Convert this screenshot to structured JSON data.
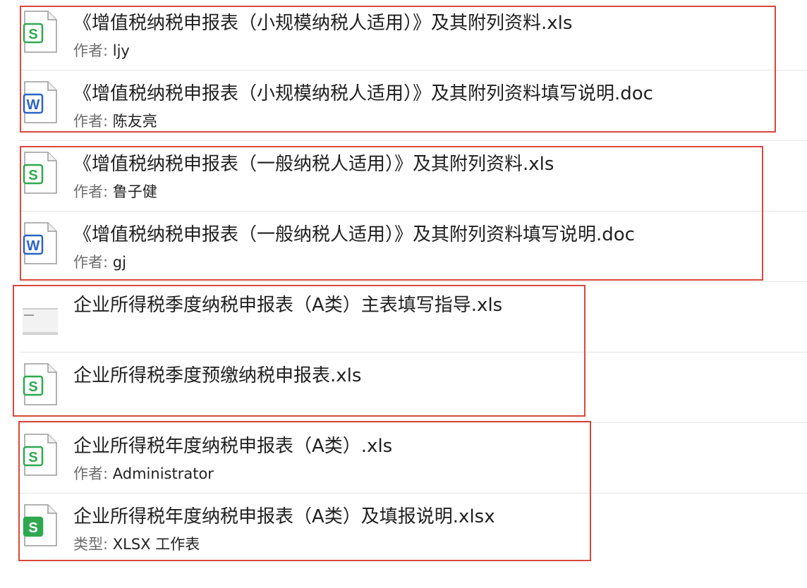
{
  "files": [
    {
      "title": "《增值税纳税申报表（小规模纳税人适用）》及其附列资料.xls",
      "meta_label": "作者: ",
      "meta_value": "ljy",
      "icon": "spreadsheet-icon"
    },
    {
      "title": "《增值税纳税申报表（小规模纳税人适用）》及其附列资料填写说明.doc",
      "meta_label": "作者: ",
      "meta_value": "陈友亮",
      "icon": "word-document-icon"
    },
    {
      "title": "《增值税纳税申报表（一般纳税人适用）》及其附列资料.xls",
      "meta_label": "作者: ",
      "meta_value": "鲁子健",
      "icon": "spreadsheet-icon"
    },
    {
      "title": "《增值税纳税申报表（一般纳税人适用）》及其附列资料填写说明.doc",
      "meta_label": "作者: ",
      "meta_value": "gj",
      "icon": "word-document-icon"
    },
    {
      "title": "企业所得税季度纳税申报表（A类）主表填写指导.xls",
      "meta_label": "",
      "meta_value": "",
      "icon": "file-thumbnail-icon"
    },
    {
      "title": "企业所得税季度预缴纳税申报表.xls",
      "meta_label": "",
      "meta_value": "",
      "icon": "spreadsheet-icon"
    },
    {
      "title": "企业所得税年度纳税申报表（A类）.xls",
      "meta_label": "作者: ",
      "meta_value": "Administrator",
      "icon": "spreadsheet-icon"
    },
    {
      "title": "企业所得税年度纳税申报表（A类）及填报说明.xlsx",
      "meta_label": "类型: ",
      "meta_value": "XLSX 工作表",
      "icon": "spreadsheet-xlsx-icon"
    }
  ],
  "colors": {
    "highlight_box": "#d9483b",
    "spreadsheet_green": "#2fa84f",
    "word_blue": "#2b63c6"
  }
}
